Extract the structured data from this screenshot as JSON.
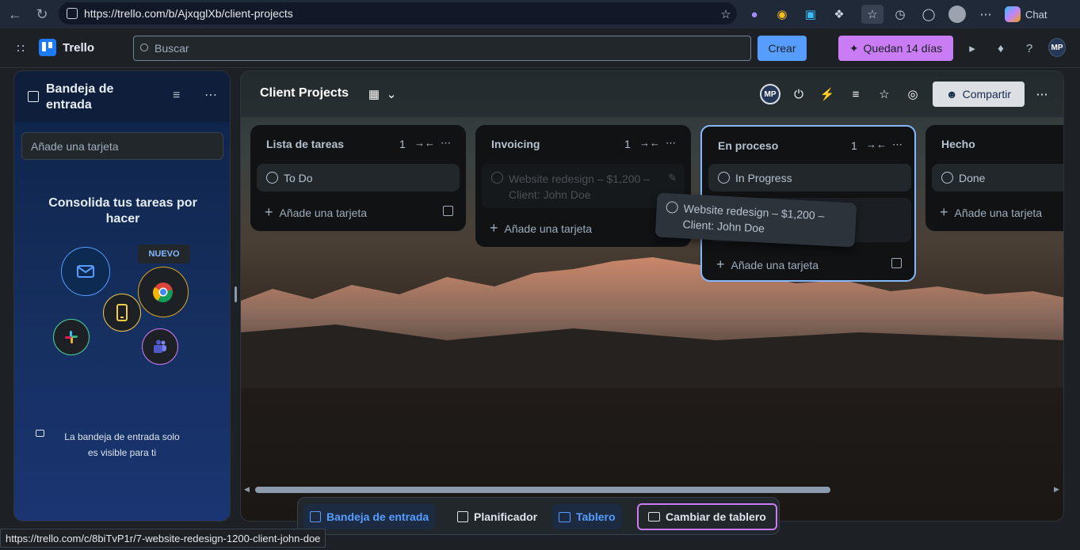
{
  "browser": {
    "url": "https://trello.com/b/AjxqglXb/client-projects",
    "chat_label": "Chat",
    "status_url": "https://trello.com/c/8biTvP1r/7-website-redesign-1200-client-john-doe"
  },
  "header": {
    "app_name": "Trello",
    "search_placeholder": "Buscar",
    "create_label": "Crear",
    "trial_label": "Quedan 14 días",
    "avatar_initials": "MP"
  },
  "inbox": {
    "title": "Bandeja de entrada",
    "add_card_placeholder": "Añade una tarjeta",
    "promo_title": "Consolida tus tareas por hacer",
    "new_badge": "NUEVO",
    "visibility_note": "La bandeja de entrada solo es visible para ti"
  },
  "board": {
    "title": "Client Projects",
    "share_label": "Compartir",
    "member_initials": "MP",
    "lists": [
      {
        "title": "Lista de tareas",
        "count": "1",
        "cards": [
          "To Do"
        ],
        "add_label": "Añade una tarjeta"
      },
      {
        "title": "Invoicing",
        "count": "1",
        "cards": [
          "Website redesign – $1,200 – Client: John Doe"
        ],
        "add_label": "Añade una tarjeta"
      },
      {
        "title": "En proceso",
        "count": "1",
        "cards": [
          "In Progress"
        ],
        "add_label": "Añade una tarjeta"
      },
      {
        "title": "Hecho",
        "count": "",
        "cards": [
          "Done"
        ],
        "add_label": "Añade una tarjeta"
      }
    ],
    "dragging_card": "Website redesign – $1,200 – Client: John Doe"
  },
  "switcher": {
    "items": [
      "Bandeja de entrada",
      "Planificador",
      "Tablero",
      "Cambiar de tablero"
    ]
  },
  "colors": {
    "accent": "#579dff",
    "trial": "#c97cf4",
    "list_bg": "#101214",
    "card_bg": "#22272b"
  }
}
